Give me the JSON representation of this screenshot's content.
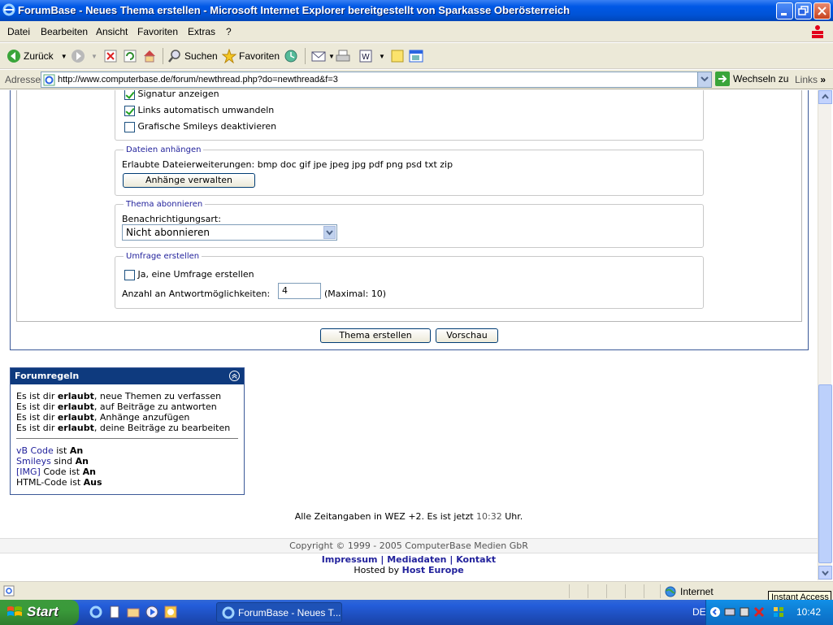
{
  "window": {
    "title": "ForumBase - Neues Thema erstellen - Microsoft Internet Explorer bereitgestellt von Sparkasse Oberösterreich"
  },
  "menu": [
    "Datei",
    "Bearbeiten",
    "Ansicht",
    "Favoriten",
    "Extras",
    "?"
  ],
  "toolbar": {
    "back": "Zurück",
    "search": "Suchen",
    "favorites": "Favoriten"
  },
  "address": {
    "label": "Adresse",
    "url": "http://www.computerbase.de/forum/newthread.php?do=newthread&f=3",
    "go": "Wechseln zu",
    "links": "Links"
  },
  "options": {
    "signature": "Signatur anzeigen",
    "autolinks": "Links automatisch umwandeln",
    "nosmileys": "Grafische Smileys deaktivieren"
  },
  "attachments": {
    "legend": "Dateien anhängen",
    "allowed": "Erlaubte Dateierweiterungen: bmp doc gif jpe jpeg jpg pdf png psd txt zip",
    "button": "Anhänge verwalten"
  },
  "subscribe": {
    "legend": "Thema abonnieren",
    "label": "Benachrichtigungsart:",
    "selected": "Nicht abonnieren"
  },
  "poll": {
    "legend": "Umfrage erstellen",
    "checkbox": "Ja, eine Umfrage erstellen",
    "count_label": "Anzahl an Antwortmöglichkeiten:",
    "count_value": "4",
    "max": "(Maximal: 10)"
  },
  "actions": {
    "submit": "Thema erstellen",
    "preview": "Vorschau"
  },
  "rules": {
    "title": "Forumregeln",
    "lines": [
      {
        "pre": "Es ist dir ",
        "bold": "erlaubt",
        "post": ", neue Themen zu verfassen"
      },
      {
        "pre": "Es ist dir ",
        "bold": "erlaubt",
        "post": ", auf Beiträge zu antworten"
      },
      {
        "pre": "Es ist dir ",
        "bold": "erlaubt",
        "post": ", Anhänge anzufügen"
      },
      {
        "pre": "Es ist dir ",
        "bold": "erlaubt",
        "post": ", deine Beiträge zu bearbeiten"
      }
    ],
    "codes": [
      {
        "link": "vB Code",
        "text": " ist ",
        "state": "An"
      },
      {
        "link": "Smileys",
        "text": " sind ",
        "state": "An"
      },
      {
        "link": "[IMG]",
        "text": " Code ist ",
        "state": "An"
      },
      {
        "link": "",
        "text": "HTML-Code ist ",
        "state": "Aus"
      }
    ]
  },
  "footer": {
    "time_pre": "Alle Zeitangaben in WEZ +2. Es ist jetzt ",
    "time": "10:32",
    "time_post": " Uhr.",
    "copyright": "Copyright © 1999 - 2005 ComputerBase Medien GbR",
    "links": [
      "Impressum",
      "Mediadaten",
      "Kontakt"
    ],
    "hosted_pre": "Hosted by ",
    "hosted_link": "Host Europe"
  },
  "status": {
    "zone": "Internet",
    "tooltip": "Instant Access"
  },
  "taskbar": {
    "start": "Start",
    "task": "ForumBase - Neues T...",
    "lang": "DE",
    "clock": "10:42"
  }
}
